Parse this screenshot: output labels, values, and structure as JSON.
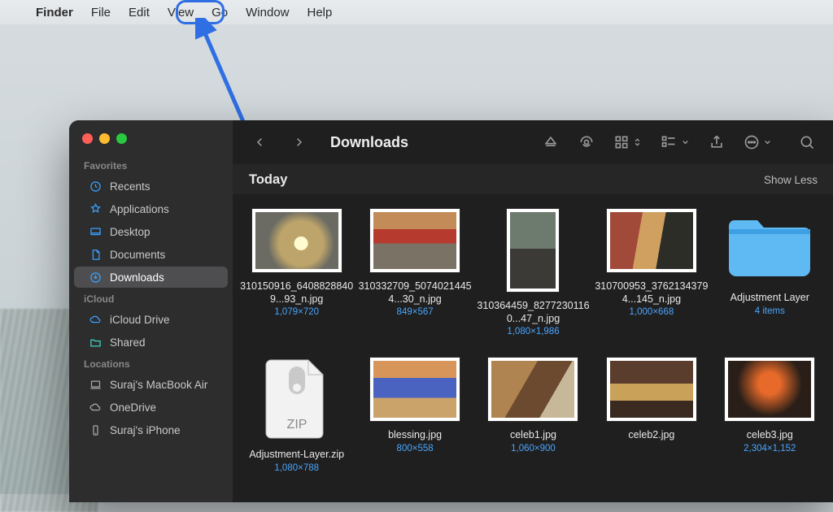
{
  "menubar": {
    "app": "Finder",
    "items": [
      "File",
      "Edit",
      "View",
      "Go",
      "Window",
      "Help"
    ],
    "highlighted_index": 2
  },
  "window": {
    "title": "Downloads"
  },
  "toolbar": {
    "back_icon": "chevron-left-icon",
    "forward_icon": "chevron-right-icon",
    "eject_icon": "eject-icon",
    "airdrop_icon": "airdrop-icon",
    "grid_view_icon": "grid-view-icon",
    "group_icon": "group-by-icon",
    "share_icon": "share-icon",
    "more_icon": "ellipsis-circle-icon",
    "search_icon": "search-icon"
  },
  "sidebar": {
    "sections": [
      {
        "header": "Favorites",
        "items": [
          {
            "icon": "clock-icon",
            "label": "Recents",
            "active": false
          },
          {
            "icon": "app-icon",
            "label": "Applications",
            "active": false
          },
          {
            "icon": "desktop-icon",
            "label": "Desktop",
            "active": false
          },
          {
            "icon": "document-icon",
            "label": "Documents",
            "active": false
          },
          {
            "icon": "download-icon",
            "label": "Downloads",
            "active": true
          }
        ]
      },
      {
        "header": "iCloud",
        "items": [
          {
            "icon": "cloud-icon",
            "label": "iCloud Drive",
            "active": false
          },
          {
            "icon": "shared-folder-icon",
            "label": "Shared",
            "active": false
          }
        ]
      },
      {
        "header": "Locations",
        "items": [
          {
            "icon": "laptop-icon",
            "label": "Suraj's MacBook Air",
            "active": false
          },
          {
            "icon": "cloud-icon",
            "label": "OneDrive",
            "active": false
          },
          {
            "icon": "phone-icon",
            "label": "Suraj's iPhone",
            "active": false
          }
        ]
      }
    ]
  },
  "content": {
    "group_label": "Today",
    "show_less_label": "Show Less",
    "files": [
      {
        "name": "310150916_64088288409...93_n.jpg",
        "meta": "1,079×720",
        "kind": "image"
      },
      {
        "name": "310332709_50740214454...30_n.jpg",
        "meta": "849×567",
        "kind": "image"
      },
      {
        "name": "310364459_82772301160...47_n.jpg",
        "meta": "1,080×1,986",
        "kind": "image-portrait"
      },
      {
        "name": "310700953_37621343794...145_n.jpg",
        "meta": "1,000×668",
        "kind": "image"
      },
      {
        "name": "Adjustment  Layer",
        "meta": "4 items",
        "kind": "folder"
      },
      {
        "name": "Adjustment-Layer.zip",
        "meta": "1,080×788",
        "kind": "zip"
      },
      {
        "name": "blessing.jpg",
        "meta": "800×558",
        "kind": "image"
      },
      {
        "name": "celeb1.jpg",
        "meta": "1,060×900",
        "kind": "image"
      },
      {
        "name": "celeb2.jpg",
        "meta": "",
        "kind": "image"
      },
      {
        "name": "celeb3.jpg",
        "meta": "2,304×1,152",
        "kind": "image"
      }
    ]
  }
}
